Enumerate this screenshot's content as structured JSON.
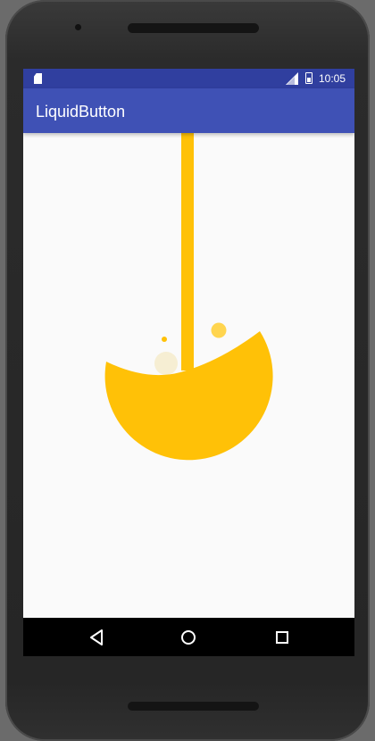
{
  "status_bar": {
    "time": "10:05",
    "icons": [
      "sd-card-icon",
      "signal-icon",
      "battery-icon"
    ]
  },
  "app_bar": {
    "title": "LiquidButton"
  },
  "liquid_button": {
    "color": "#FFC107",
    "bubble_color": "#FFD54F",
    "faint_bubble_color": "#F5EBCB"
  },
  "nav_bar": {
    "buttons": [
      "back-icon",
      "home-icon",
      "recents-icon"
    ]
  },
  "colors": {
    "status_bar": "#303F9F",
    "app_bar": "#3F51B5",
    "background": "#FAFAFA",
    "nav_bar": "#000000"
  }
}
